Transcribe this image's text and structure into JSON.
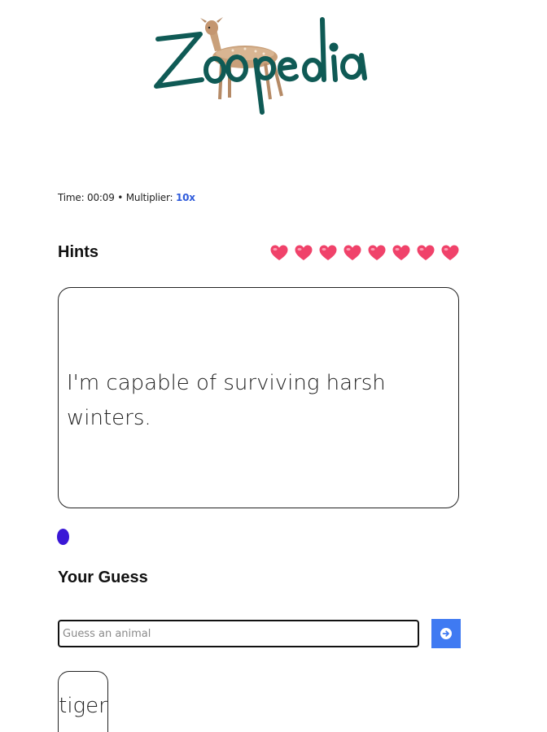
{
  "logo": {
    "text": "Zoopedia"
  },
  "status": {
    "time_label": "Time:",
    "time_value": "00:09",
    "separator": "•",
    "multiplier_label": "Multiplier:",
    "multiplier_value": "10x"
  },
  "hints": {
    "title": "Hints",
    "lives_remaining": 8,
    "heart_icon": "heart-icon",
    "current_hint": "I'm capable of surviving harsh winters."
  },
  "progress": {
    "current_hint_index": 1,
    "total_hints_shown": 1
  },
  "guess": {
    "title": "Your Guess",
    "input_value": "",
    "placeholder": "Guess an animal",
    "submit_icon": "arrow-right-icon"
  },
  "previous_guesses": [
    "tiger"
  ],
  "colors": {
    "brand_green": "#0f5a55",
    "multiplier_blue": "#2f5bdb",
    "heart_pink": "#f0426a",
    "progress_dot": "#3a17d6",
    "submit_blue": "#3f7af2"
  }
}
